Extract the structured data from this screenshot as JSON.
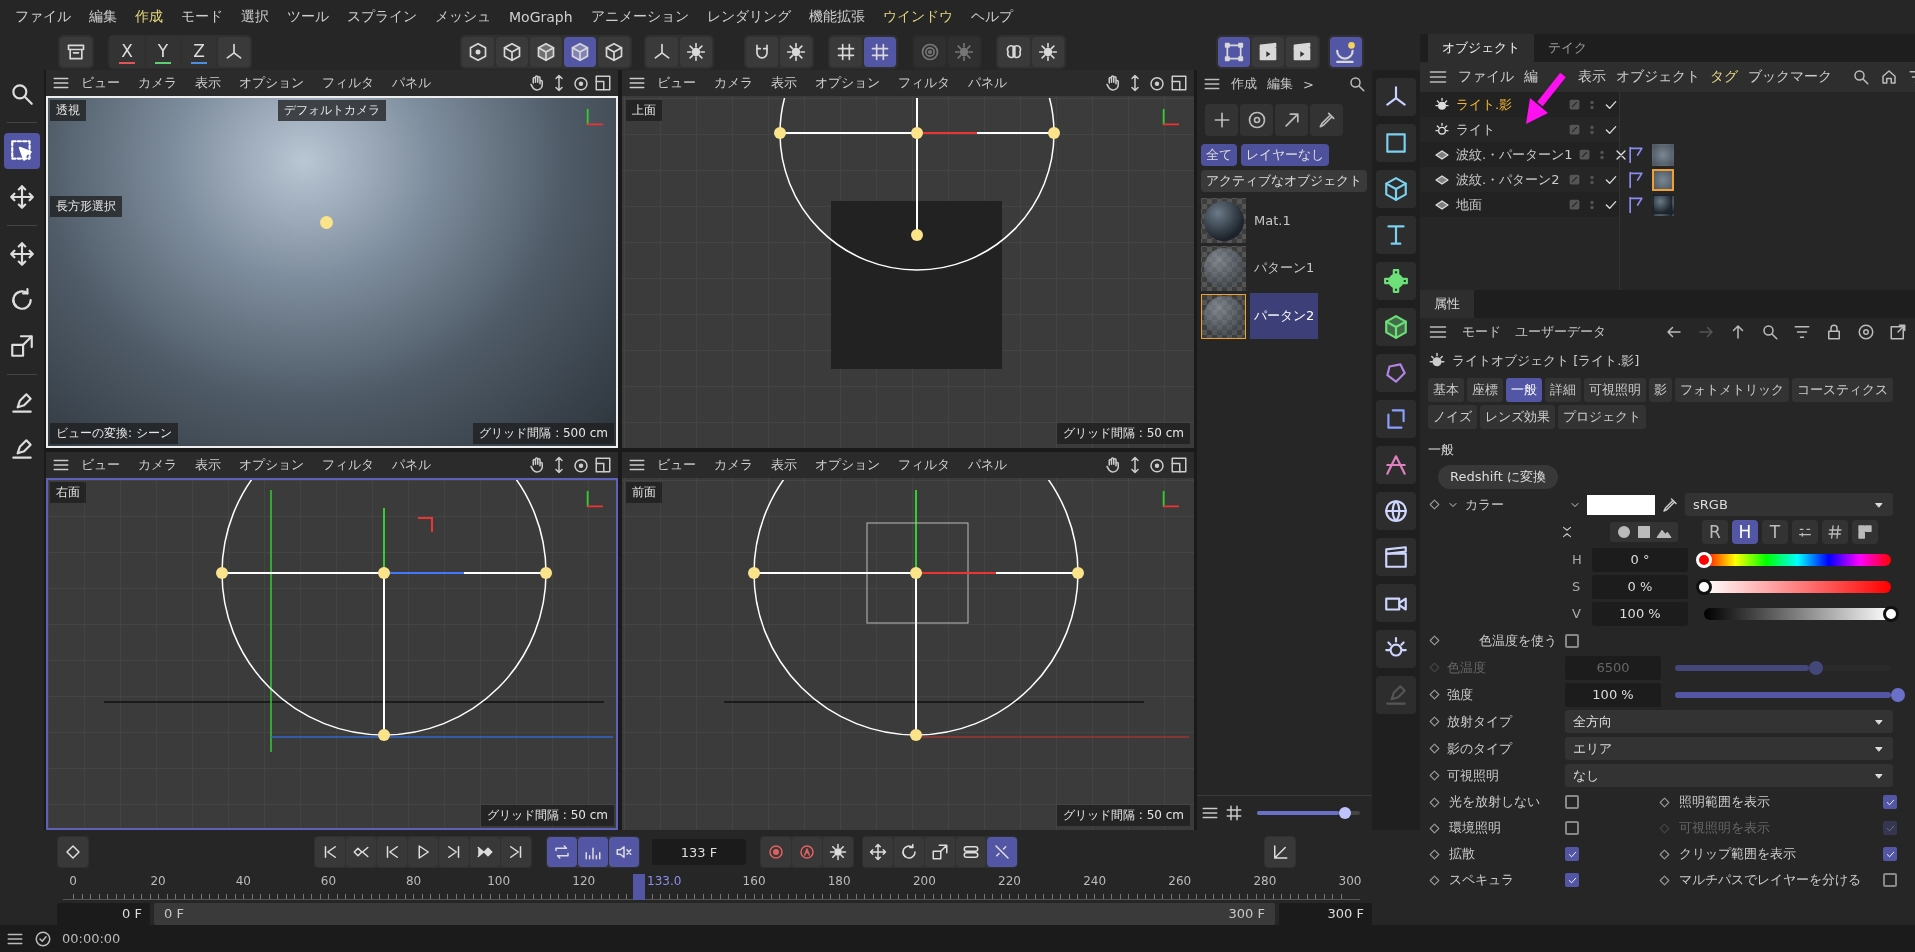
{
  "menu": [
    {
      "label": "ファイル",
      "highlighted": false
    },
    {
      "label": "編集",
      "highlighted": false
    },
    {
      "label": "作成",
      "highlighted": true
    },
    {
      "label": "モード",
      "highlighted": false
    },
    {
      "label": "選択",
      "highlighted": false
    },
    {
      "label": "ツール",
      "highlighted": false
    },
    {
      "label": "スプライン",
      "highlighted": false
    },
    {
      "label": "メッシュ",
      "highlighted": false
    },
    {
      "label": "MoGraph",
      "highlighted": false
    },
    {
      "label": "アニメーション",
      "highlighted": false
    },
    {
      "label": "レンダリング",
      "highlighted": false
    },
    {
      "label": "機能拡張",
      "highlighted": false
    },
    {
      "label": "ウインドウ",
      "highlighted": true
    },
    {
      "label": "ヘルプ",
      "highlighted": false
    }
  ],
  "toolbar": {
    "axes": [
      {
        "label": "X",
        "color": "#e05555"
      },
      {
        "label": "Y",
        "color": "#5fce6f"
      },
      {
        "label": "Z",
        "color": "#4a8fe0"
      }
    ],
    "modes": [
      {
        "selected": false
      },
      {
        "selected": false
      },
      {
        "selected": false
      },
      {
        "selected": true
      },
      {
        "selected": false
      }
    ],
    "snap": [
      {
        "selected": false
      },
      {
        "selected": true
      }
    ],
    "render": [
      {
        "selected": true
      },
      {
        "selected": false
      },
      {
        "selected": false
      }
    ]
  },
  "viewports": [
    {
      "kind": "perspective",
      "title": "透視",
      "active": true,
      "focused": false,
      "menu": [
        "ビュー",
        "カメラ",
        "表示",
        "オプション",
        "フィルタ",
        "パネル"
      ],
      "camera": "デフォルトカメラ",
      "selection_hint": "長方形選択",
      "transform_hint": "ビューの変換: シーン",
      "grid": "グリッド間隔 : 500 cm"
    },
    {
      "kind": "top",
      "title": "上面",
      "active": false,
      "focused": false,
      "menu": [
        "ビュー",
        "カメラ",
        "表示",
        "オプション",
        "フィルタ",
        "パネル"
      ],
      "grid": "グリッド間隔 : 50 cm"
    },
    {
      "kind": "right",
      "title": "右面",
      "active": false,
      "focused": true,
      "menu": [
        "ビュー",
        "カメラ",
        "表示",
        "オプション",
        "フィルタ",
        "パネル"
      ],
      "grid": "グリッド間隔 : 50 cm"
    },
    {
      "kind": "front",
      "title": "前面",
      "active": false,
      "focused": false,
      "menu": [
        "ビュー",
        "カメラ",
        "表示",
        "オプション",
        "フィルタ",
        "パネル"
      ],
      "grid": "グリッド間隔 : 50 cm"
    }
  ],
  "materials": {
    "menu": [
      "作成",
      "編集",
      ">"
    ],
    "filters": [
      {
        "label": "全て",
        "on": true
      },
      {
        "label": "レイヤーなし",
        "on": true
      }
    ],
    "active_filter": "アクティブなオブジェクト",
    "items": [
      {
        "name": "Mat.1",
        "kind": "sphere",
        "selected": false
      },
      {
        "name": "パターン1",
        "kind": "pattern",
        "selected": false
      },
      {
        "name": "パータン2",
        "kind": "pattern",
        "selected": true
      }
    ],
    "thumb_size": {
      "level": 0.8
    }
  },
  "objects": {
    "tabs": [
      {
        "label": "オブジェクト",
        "selected": true
      },
      {
        "label": "テイク",
        "selected": false
      }
    ],
    "menu": [
      "ファイル",
      "編",
      "表示",
      "オブジェクト",
      "タグ",
      "ブックマーク"
    ],
    "items": [
      {
        "name": "ライト.影",
        "kind": "light",
        "active": true,
        "enabled": true
      },
      {
        "name": "ライト",
        "kind": "light",
        "active": false,
        "enabled": true
      },
      {
        "name": "波紋.・パーターン1",
        "kind": "plane",
        "active": false,
        "enabled": false,
        "tags": [
          {
            "kind": "phong"
          },
          {
            "kind": "pattern",
            "selected": false
          }
        ]
      },
      {
        "name": "波紋.・パターン2",
        "kind": "plane",
        "active": false,
        "enabled": true,
        "tags": [
          {
            "kind": "phong"
          },
          {
            "kind": "pattern",
            "selected": true
          }
        ]
      },
      {
        "name": "地面",
        "kind": "plane",
        "active": false,
        "enabled": true,
        "tags": [
          {
            "kind": "phong"
          },
          {
            "kind": "sphere",
            "selected": false
          }
        ]
      }
    ]
  },
  "attributes": {
    "tab": "属性",
    "menu": [
      "モード",
      "ユーザーデータ"
    ],
    "title": "ライトオブジェクト [ライト.影]",
    "tabs": [
      {
        "label": "基本",
        "selected": false
      },
      {
        "label": "座標",
        "selected": false
      },
      {
        "label": "一般",
        "selected": true
      },
      {
        "label": "詳細",
        "selected": false
      },
      {
        "label": "可視照明",
        "selected": false
      },
      {
        "label": "影",
        "selected": false
      },
      {
        "label": "フォトメトリック",
        "selected": false
      },
      {
        "label": "コースティクス",
        "selected": false
      },
      {
        "label": "ノイズ",
        "selected": false
      },
      {
        "label": "レンズ効果",
        "selected": false
      },
      {
        "label": "プロジェクト",
        "selected": false
      }
    ],
    "section": "一般",
    "convert": "Redshift に変換",
    "color": {
      "label": "カラー",
      "space": "sRGB",
      "modes": [
        {
          "label": "R",
          "selected": false
        },
        {
          "label": "H",
          "selected": true
        },
        {
          "label": "T",
          "selected": false
        }
      ],
      "channels": [
        {
          "label": "H",
          "value": "0 °",
          "level": 0,
          "kind": "hue"
        },
        {
          "label": "S",
          "value": "0 %",
          "level": 0,
          "kind": "saturation"
        },
        {
          "label": "V",
          "value": "100 %",
          "level": 1,
          "kind": "value"
        }
      ]
    },
    "rows": [
      {
        "kind": "checkbox",
        "label": "色温度を使う",
        "checked": false,
        "disabled": false
      },
      {
        "kind": "slider",
        "label": "色温度",
        "value": "6500",
        "level": 0.62,
        "disabled": true
      },
      {
        "kind": "slider",
        "label": "強度",
        "value": "100 %",
        "level": 1,
        "disabled": false
      },
      {
        "kind": "dropdown",
        "label": "放射タイプ",
        "value": "全方向"
      },
      {
        "kind": "dropdown",
        "label": "影のタイプ",
        "value": "エリア"
      },
      {
        "kind": "dropdown",
        "label": "可視照明",
        "value": "なし"
      }
    ],
    "checks": [
      {
        "label": "光を放射しない",
        "checked": false,
        "disabled": false
      },
      {
        "label": "照明範囲を表示",
        "checked": true,
        "disabled": false
      },
      {
        "label": "環境照明",
        "checked": false,
        "disabled": false
      },
      {
        "label": "可視照明を表示",
        "checked": true,
        "disabled": true
      },
      {
        "label": "拡散",
        "checked": true,
        "disabled": false
      },
      {
        "label": "クリップ範囲を表示",
        "checked": true,
        "disabled": false
      },
      {
        "label": "スペキュラ",
        "checked": true,
        "disabled": false
      },
      {
        "label": "マルチパスでレイヤーを分ける",
        "checked": false,
        "disabled": false
      }
    ]
  },
  "timeline": {
    "frame": "133 F",
    "ticks": [
      "0",
      "20",
      "40",
      "60",
      "80",
      "100",
      "120",
      "160",
      "180",
      "200",
      "220",
      "240",
      "260",
      "280",
      "300"
    ],
    "playhead": {
      "label": "133.0",
      "level": 0.4433
    },
    "start": "0 F",
    "range_start": "0 F",
    "range_end": "300 F",
    "end": "300 F"
  },
  "status": {
    "time": "00:00:00"
  }
}
